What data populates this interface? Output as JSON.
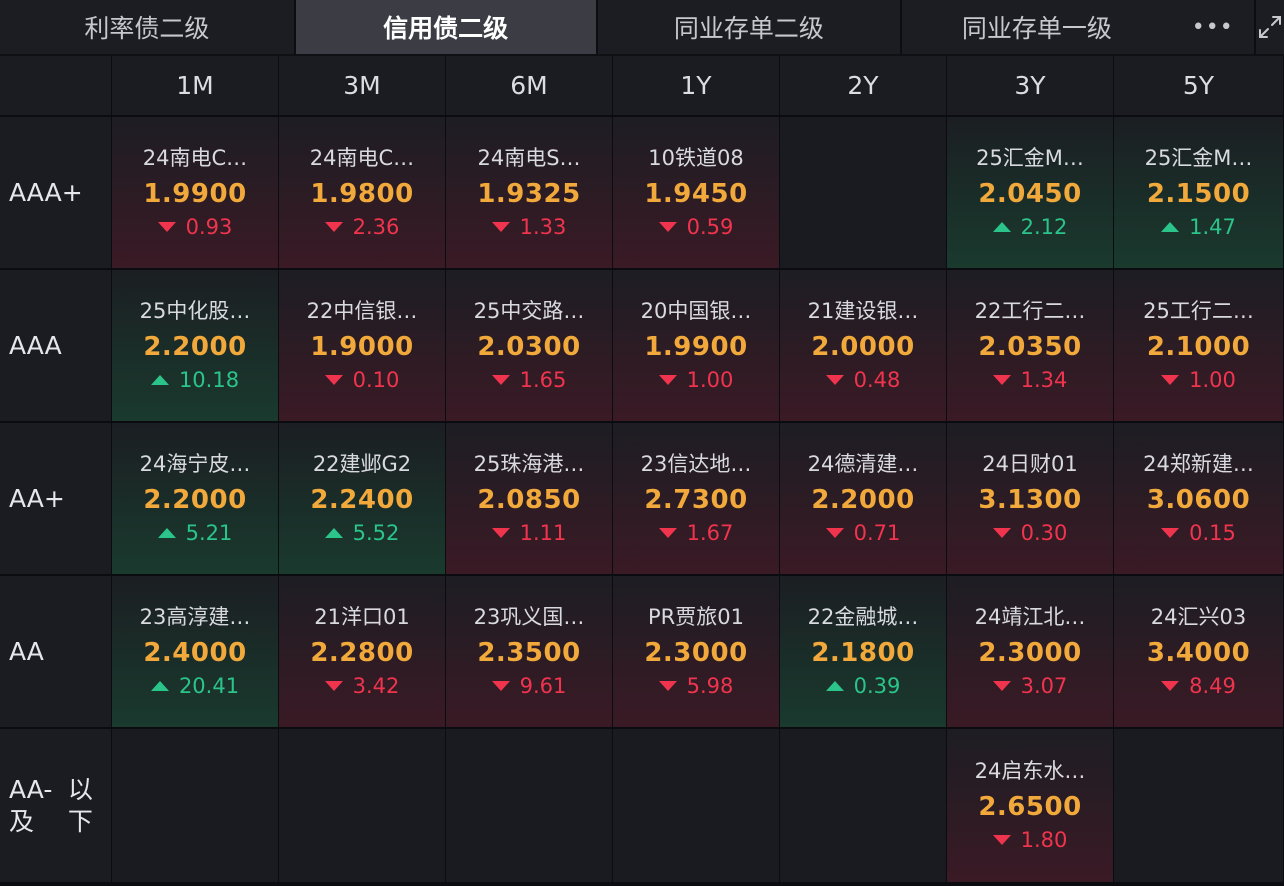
{
  "tabs": [
    {
      "label": "利率债二级",
      "active": false
    },
    {
      "label": "信用债二级",
      "active": true
    },
    {
      "label": "同业存单二级",
      "active": false
    },
    {
      "label": "同业存单一级",
      "active": false
    }
  ],
  "more_label": "•••",
  "columns": [
    "1M",
    "3M",
    "6M",
    "1Y",
    "2Y",
    "3Y",
    "5Y"
  ],
  "rows": [
    {
      "label": "AAA+",
      "cells": [
        {
          "name": "24南电C…",
          "price": "1.9900",
          "change": "0.93",
          "dir": "down"
        },
        {
          "name": "24南电C…",
          "price": "1.9800",
          "change": "2.36",
          "dir": "down"
        },
        {
          "name": "24南电S…",
          "price": "1.9325",
          "change": "1.33",
          "dir": "down"
        },
        {
          "name": "10铁道08",
          "price": "1.9450",
          "change": "0.59",
          "dir": "down"
        },
        null,
        {
          "name": "25汇金M…",
          "price": "2.0450",
          "change": "2.12",
          "dir": "up"
        },
        {
          "name": "25汇金M…",
          "price": "2.1500",
          "change": "1.47",
          "dir": "up"
        }
      ]
    },
    {
      "label": "AAA",
      "cells": [
        {
          "name": "25中化股…",
          "price": "2.2000",
          "change": "10.18",
          "dir": "up"
        },
        {
          "name": "22中信银…",
          "price": "1.9000",
          "change": "0.10",
          "dir": "down"
        },
        {
          "name": "25中交路…",
          "price": "2.0300",
          "change": "1.65",
          "dir": "down"
        },
        {
          "name": "20中国银…",
          "price": "1.9900",
          "change": "1.00",
          "dir": "down"
        },
        {
          "name": "21建设银…",
          "price": "2.0000",
          "change": "0.48",
          "dir": "down"
        },
        {
          "name": "22工行二…",
          "price": "2.0350",
          "change": "1.34",
          "dir": "down"
        },
        {
          "name": "25工行二…",
          "price": "2.1000",
          "change": "1.00",
          "dir": "down"
        }
      ]
    },
    {
      "label": "AA+",
      "cells": [
        {
          "name": "24海宁皮…",
          "price": "2.2000",
          "change": "5.21",
          "dir": "up"
        },
        {
          "name": "22建邺G2",
          "price": "2.2400",
          "change": "5.52",
          "dir": "up"
        },
        {
          "name": "25珠海港…",
          "price": "2.0850",
          "change": "1.11",
          "dir": "down"
        },
        {
          "name": "23信达地…",
          "price": "2.7300",
          "change": "1.67",
          "dir": "down"
        },
        {
          "name": "24德清建…",
          "price": "2.2000",
          "change": "0.71",
          "dir": "down"
        },
        {
          "name": "24日财01",
          "price": "3.1300",
          "change": "0.30",
          "dir": "down"
        },
        {
          "name": "24郑新建…",
          "price": "3.0600",
          "change": "0.15",
          "dir": "down"
        }
      ]
    },
    {
      "label": "AA",
      "cells": [
        {
          "name": "23高淳建…",
          "price": "2.4000",
          "change": "20.41",
          "dir": "up"
        },
        {
          "name": "21洋口01",
          "price": "2.2800",
          "change": "3.42",
          "dir": "down"
        },
        {
          "name": "23巩义国…",
          "price": "2.3500",
          "change": "9.61",
          "dir": "down"
        },
        {
          "name": "PR贾旅01",
          "price": "2.3000",
          "change": "5.98",
          "dir": "down"
        },
        {
          "name": "22金融城…",
          "price": "2.1800",
          "change": "0.39",
          "dir": "up"
        },
        {
          "name": "24靖江北…",
          "price": "2.3000",
          "change": "3.07",
          "dir": "down"
        },
        {
          "name": "24汇兴03",
          "price": "3.4000",
          "change": "8.49",
          "dir": "down"
        }
      ]
    },
    {
      "label": "AA-及以下",
      "label_lines": [
        "AA-及",
        "以下"
      ],
      "cells": [
        null,
        null,
        null,
        null,
        null,
        {
          "name": "24启东水…",
          "price": "2.6500",
          "change": "1.80",
          "dir": "down"
        },
        null
      ]
    }
  ],
  "colors": {
    "price": "#f2a93b",
    "down": "#f0344e",
    "up": "#2bc48a",
    "active_tab": "#3b3c44"
  },
  "icons": {
    "more": "more-dots-icon",
    "expand": "expand-icon"
  }
}
